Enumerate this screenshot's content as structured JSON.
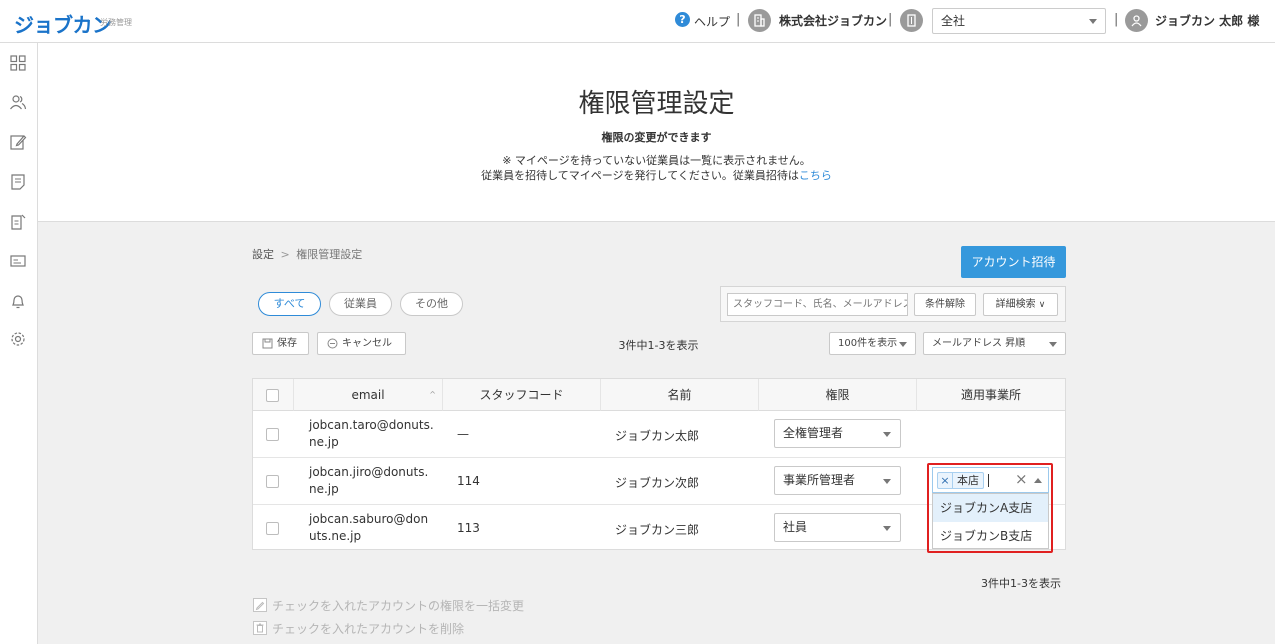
{
  "header": {
    "logo": "ジョブカン",
    "logo_sub": "労務管理",
    "help_label": "ヘルプ",
    "company": "株式会社ジョブカン",
    "scope_value": "全社",
    "user_name": "ジョブカン 太郎 様",
    "accent_color": "#2f8bd8"
  },
  "sidebar": {
    "icons": [
      "dashboard-icon",
      "employees-icon",
      "edit-icon",
      "document-icon",
      "report-icon",
      "card-icon",
      "bell-icon",
      "gear-icon"
    ]
  },
  "hero": {
    "title": "権限管理設定",
    "subtitle": "権限の変更ができます",
    "note1": "※ マイページを持っていない従業員は一覧に表示されません。",
    "note2_prefix": "従業員を招待してマイページを発行してください。従業員招待は",
    "note2_link": "こちら"
  },
  "breadcrumb": {
    "parent": "設定",
    "separator": ">",
    "current": "権限管理設定"
  },
  "invite_button": "アカウント招待",
  "tabs": [
    {
      "label": "すべて",
      "active": true
    },
    {
      "label": "従業員",
      "active": false
    },
    {
      "label": "その他",
      "active": false
    }
  ],
  "filters": {
    "search_placeholder": "スタッフコード、氏名、メールアドレス",
    "clear_label": "条件解除",
    "advanced_label": "詳細検索"
  },
  "toolbar": {
    "save_label": "保存",
    "cancel_label": "キャンセル",
    "count_text": "3件中1-3を表示",
    "per_page": "100件を表示",
    "sort": "メールアドレス 昇順"
  },
  "table": {
    "headers": [
      "email",
      "スタッフコード",
      "名前",
      "権限",
      "適用事業所"
    ],
    "rows": [
      {
        "email": "jobcan.taro@donuts.ne.jp",
        "code": "—",
        "name": "ジョブカン太郎",
        "role": "全権管理者"
      },
      {
        "email": "jobcan.jiro@donuts.ne.jp",
        "code": "114",
        "name": "ジョブカン次郎",
        "role": "事業所管理者"
      },
      {
        "email": "jobcan.saburo@donuts.ne.jp",
        "code": "113",
        "name": "ジョブカン三郎",
        "role": "社員"
      }
    ]
  },
  "office_select": {
    "selected_tag": "本店",
    "tag_remove": "×",
    "clear": "×",
    "options": [
      "ジョブカンA支店",
      "ジョブカンB支店"
    ]
  },
  "footer": {
    "count_text": "3件中1-3を表示",
    "bulk_change": "チェックを入れたアカウントの権限を一括変更",
    "bulk_delete": "チェックを入れたアカウントを削除"
  }
}
